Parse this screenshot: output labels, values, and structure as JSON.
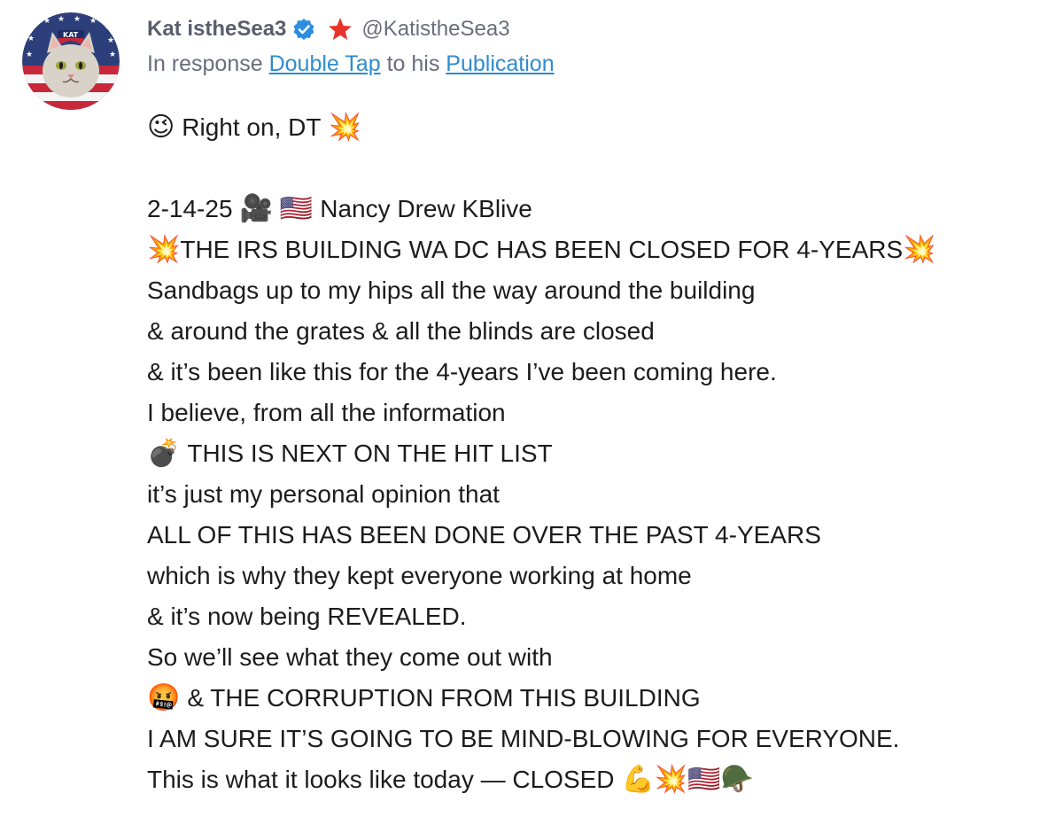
{
  "post": {
    "display_name": "Kat istheSea3",
    "handle": "@KatistheSea3",
    "reply": {
      "prefix": "In response",
      "target_link": "Double Tap",
      "middle": "to his",
      "publication_link": "Publication"
    },
    "colors": {
      "name": "#5a5d6c",
      "link": "#2f8ccf",
      "verified": "#2d8de0",
      "star": "#e8332b",
      "text": "#1c1c1e"
    },
    "icons": [
      "verified-badge-icon",
      "red-star-icon"
    ]
  },
  "body": {
    "line1": {
      "emoji_a": "😉",
      "text": "Right on, DT",
      "emoji_b": "💥"
    },
    "line2": {
      "date": "2-14-25",
      "emoji_a": "🎥",
      "emoji_b": "🇺🇸",
      "text": "Nancy Drew KBlive"
    },
    "line3": {
      "emoji_a": "💥",
      "text": "THE IRS BUILDING WA DC HAS BEEN CLOSED FOR 4-YEARS",
      "emoji_b": "💥"
    },
    "line4": "Sandbags up to my hips all the way around the building",
    "line5": "& around the grates & all the blinds are closed",
    "line6": "& it’s been like this for the 4-years I’ve been coming here.",
    "line7": "I believe, from all the information",
    "line8": {
      "emoji": "💣",
      "text": "THIS IS NEXT ON THE HIT LIST"
    },
    "line9": "it’s just my personal opinion that",
    "line10": "ALL OF THIS HAS BEEN DONE OVER THE PAST 4-YEARS",
    "line11": "which is why they kept everyone working at home",
    "line12": "& it’s now being REVEALED.",
    "line13": "So we’ll see what they come out with",
    "line14": {
      "emoji": "🤬",
      "text": "& THE CORRUPTION FROM THIS BUILDING"
    },
    "line15": "I AM SURE IT’S GOING TO BE MIND-BLOWING FOR EVERYONE.",
    "line16": {
      "text": "This is what it looks like today — CLOSED",
      "emojis": "💪💥🇺🇸🪖"
    }
  }
}
